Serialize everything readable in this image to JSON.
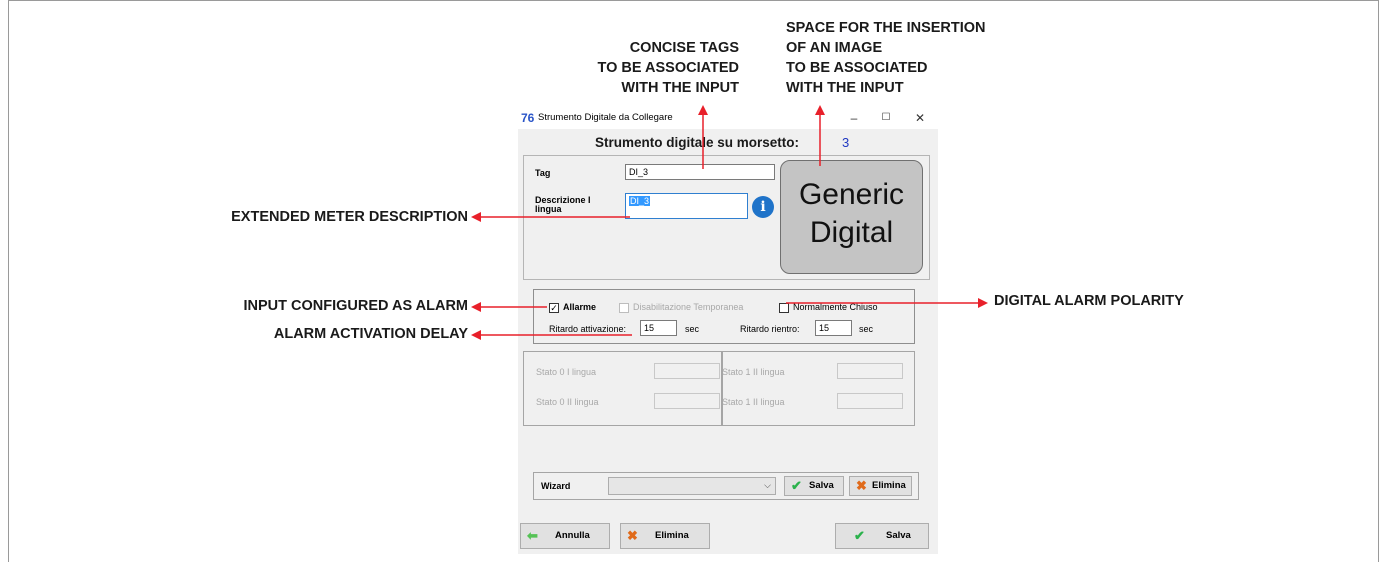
{
  "callouts": {
    "concise_tags": [
      "CONCISE TAGS",
      "TO BE ASSOCIATED",
      "WITH THE INPUT"
    ],
    "image_space": [
      "SPACE FOR THE INSERTION",
      "OF AN IMAGE",
      "TO BE ASSOCIATED",
      "WITH THE INPUT"
    ],
    "extended_desc": "EXTENDED METER DESCRIPTION",
    "alarm_config": "INPUT CONFIGURED AS ALARM",
    "alarm_delay": "ALARM ACTIVATION DELAY",
    "alarm_polarity": "DIGITAL ALARM POLARITY",
    "arrow_color": "#e8202a"
  },
  "window": {
    "title": "Strumento Digitale da Collegare",
    "minimize": "–",
    "maximize": "☐",
    "close": "✕"
  },
  "header": {
    "label": "Strumento digitale su morsetto:",
    "number": "3"
  },
  "form": {
    "tag_label": "Tag",
    "tag_value": "DI_3",
    "desc_label_1": "Descrizione I",
    "desc_label_2": "lingua",
    "desc_value": "DI_3",
    "image_text_1": "Generic",
    "image_text_2": "Digital"
  },
  "alarm": {
    "allarme_label": "Allarme",
    "allarme_checked": "✓",
    "disab_label": "Disabilitazione Temporanea",
    "norm_label": "Normalmente Chiuso",
    "ritardo_att_label": "Ritardo attivazione:",
    "ritardo_att_value": "15",
    "sec1": "sec",
    "ritardo_rie_label": "Ritardo rientro:",
    "ritardo_rie_value": "15",
    "sec2": "sec"
  },
  "states": {
    "s0_l1": "Stato 0 I lingua",
    "s0_l2": "Stato 0 II lingua",
    "s1_l1": "Stato 1 II lingua",
    "s1_l2": "Stato 1 II lingua"
  },
  "wizard": {
    "label": "Wizard",
    "combo_value": "",
    "salva": "Salva",
    "elimina": "Elimina"
  },
  "footer": {
    "annulla": "Annulla",
    "elimina": "Elimina",
    "salva": "Salva"
  }
}
